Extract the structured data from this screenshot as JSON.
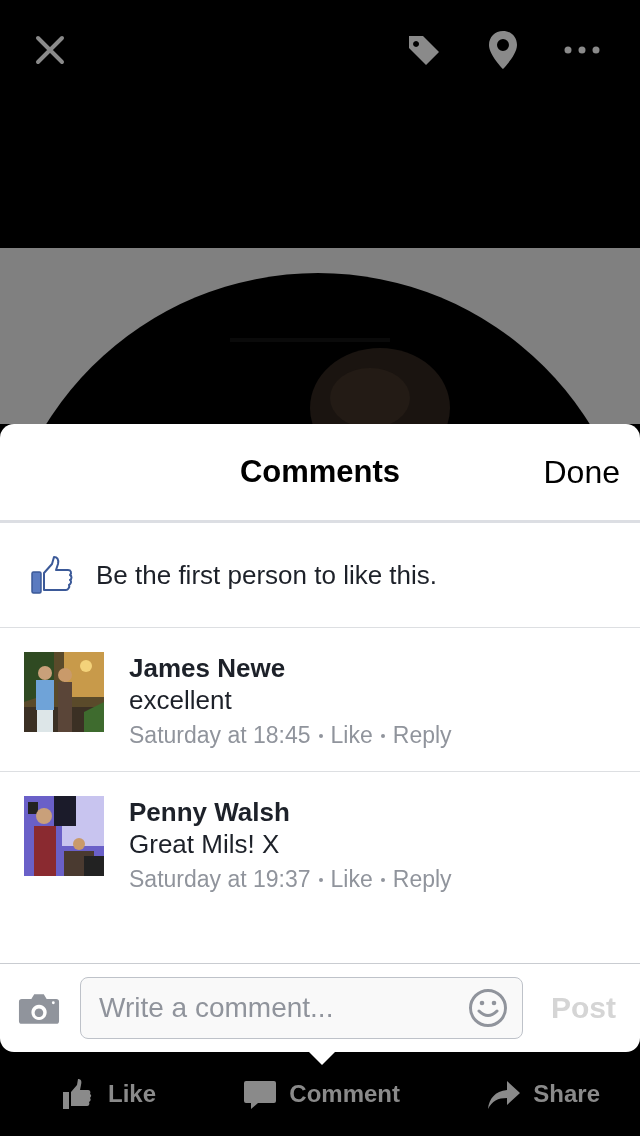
{
  "comments_sheet": {
    "title": "Comments",
    "done_label": "Done",
    "likes_summary": "Be the first person to like this.",
    "comments": [
      {
        "author": "James Newe",
        "text": "excellent",
        "time": "Saturday at 18:45",
        "like_label": "Like",
        "reply_label": "Reply"
      },
      {
        "author": "Penny Walsh",
        "text": "Great Mils! X",
        "time": "Saturday at 19:37",
        "like_label": "Like",
        "reply_label": "Reply"
      }
    ],
    "composer": {
      "placeholder": "Write a comment...",
      "post_label": "Post",
      "post_disabled": true
    }
  },
  "actions": [
    {
      "kind": "like",
      "label": "Like",
      "selected": false
    },
    {
      "kind": "comment",
      "label": "Comment",
      "selected": true
    },
    {
      "kind": "share",
      "label": "Share",
      "selected": false
    }
  ]
}
